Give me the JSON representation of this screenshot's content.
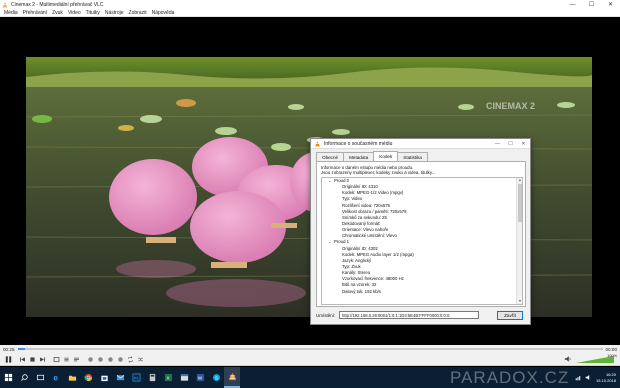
{
  "window": {
    "title": "Cinemax 2 - Multimediální přehrávač VLC",
    "minimize": "—",
    "maximize": "☐",
    "close": "✕"
  },
  "menu": [
    "Média",
    "Přehrávání",
    "Zvuk",
    "Video",
    "Titulky",
    "Nástroje",
    "Zobrazit",
    "Nápověda"
  ],
  "video": {
    "channel_logo": "CINEMAX 2"
  },
  "dialog": {
    "title": "Informace o současném médiu",
    "tabs": [
      "Obecné",
      "Metadata",
      "Kodek",
      "Statistika"
    ],
    "active_tab": "Kodek",
    "description_line1": "Informace o daném vstupu média nebo proudu.",
    "description_line2": "Jsou zobrazeny multiplexer, kodeky zvuku a videa, titulky...",
    "streams": [
      {
        "label": "Proud 0",
        "props": [
          "Originální ID: 4310",
          "Kodek: MPEG-1/2 Video (mpgv)",
          "Typ: Video",
          "Rozlišení videa: 720x576",
          "Velikost obrazu / paměti: 720x578",
          "Snímků za sekundu: 25",
          "Dekódovaný formát:",
          "Orientace: Vlevo nahoře",
          "Chromatické umístění: Vlevo"
        ]
      },
      {
        "label": "Proud 1",
        "props": [
          "Originální ID: 4302",
          "Kodek: MPEG Audio layer 1/2 (mpga)",
          "Jazyk: Anglický",
          "Typ: Zvuk",
          "Kanály: Stereo",
          "Vzorkovací frekvence: 48000 Hz",
          "Bitů na vzorek: 32",
          "Datový tok: 192 kb/s"
        ]
      }
    ],
    "location_label": "Umístění:",
    "location_value": "http://192.168.0.26:8001/1:0:1:1D3:5E4B:FFFF0000:0:0:0:",
    "close_button": "Zavřít"
  },
  "player": {
    "elapsed": "00:25",
    "remaining": "00:00",
    "seek_progress": 0.012,
    "volume_level": 1.0,
    "volume_label": "100%"
  },
  "taskbar": {
    "clock_time": "16:20",
    "clock_date": "15.10.2018"
  },
  "watermark": "PARADOX.CZ",
  "colors": {
    "accent": "#0078d7",
    "vlc_orange": "#f28a00",
    "taskbar_bg": "#0b1f34",
    "seek_fill": "#3a8ee6"
  }
}
